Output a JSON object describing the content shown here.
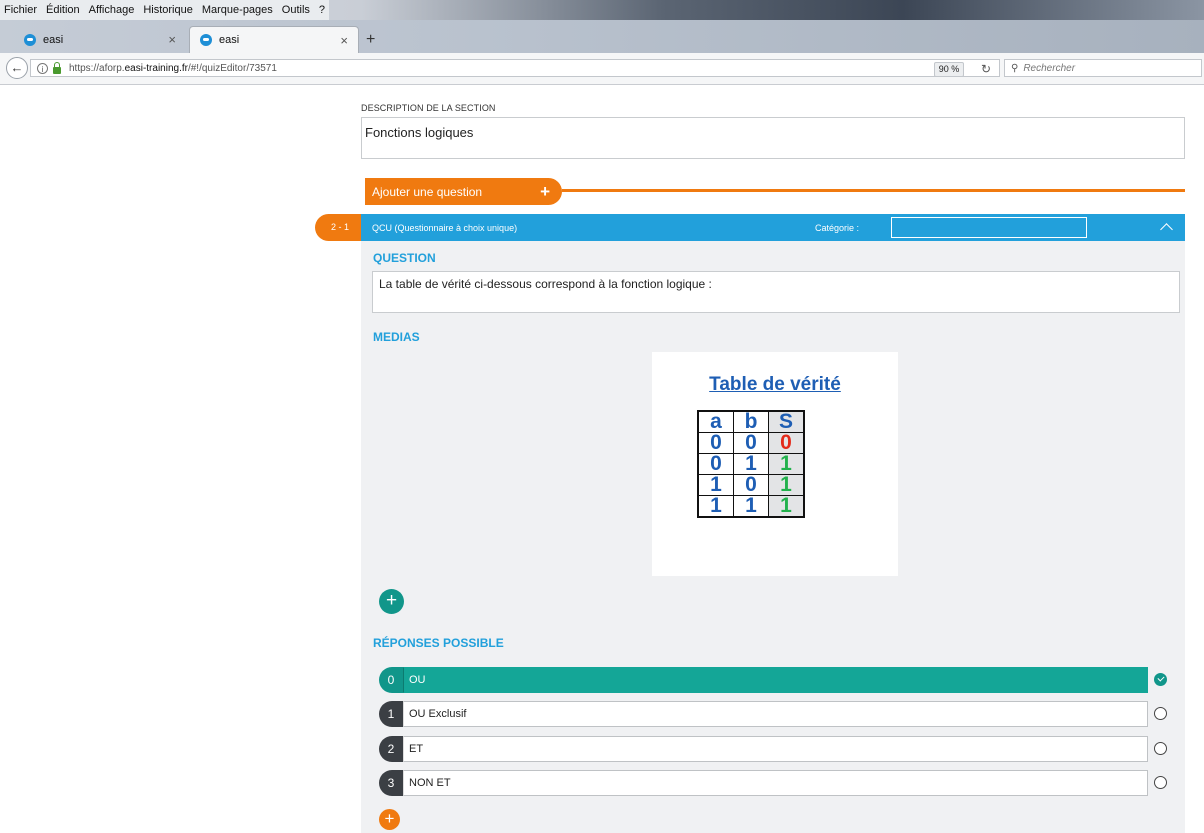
{
  "browser": {
    "menu": [
      "Fichier",
      "Édition",
      "Affichage",
      "Historique",
      "Marque-pages",
      "Outils",
      "?"
    ],
    "tabs": [
      {
        "title": "easi",
        "active": false
      },
      {
        "title": "easi",
        "active": true
      }
    ],
    "url_prefix": "https://aforp.",
    "url_domain": "easi-training.fr",
    "url_path": "/#!/quizEditor/73571",
    "zoom": "90 %",
    "search_placeholder": "Rechercher"
  },
  "section": {
    "label": "DESCRIPTION DE LA SECTION",
    "value": "Fonctions logiques"
  },
  "add_question_label": "Ajouter une question",
  "question": {
    "number": "2 - 1",
    "type": "QCU (Questionnaire à choix unique)",
    "category_label": "Catégorie :",
    "category_value": "",
    "heading": "QUESTION",
    "text": "La table de vérité ci-dessous correspond à la fonction logique :"
  },
  "medias": {
    "heading": "MEDIAS",
    "image": {
      "title": "Table de vérité",
      "headers": [
        "a",
        "b",
        "S"
      ],
      "rows": [
        [
          "0",
          "0",
          "0"
        ],
        [
          "0",
          "1",
          "1"
        ],
        [
          "1",
          "0",
          "1"
        ],
        [
          "1",
          "1",
          "1"
        ]
      ]
    }
  },
  "answers": {
    "heading": "RÉPONSES POSSIBLE",
    "items": [
      {
        "index": "0",
        "label": "OU",
        "correct": true
      },
      {
        "index": "1",
        "label": "OU Exclusif",
        "correct": false
      },
      {
        "index": "2",
        "label": "ET",
        "correct": false
      },
      {
        "index": "3",
        "label": "NON ET",
        "correct": false
      }
    ]
  },
  "colors": {
    "accent_orange": "#f07a10",
    "header_blue": "#22a0db",
    "correct_teal": "#14a697"
  }
}
